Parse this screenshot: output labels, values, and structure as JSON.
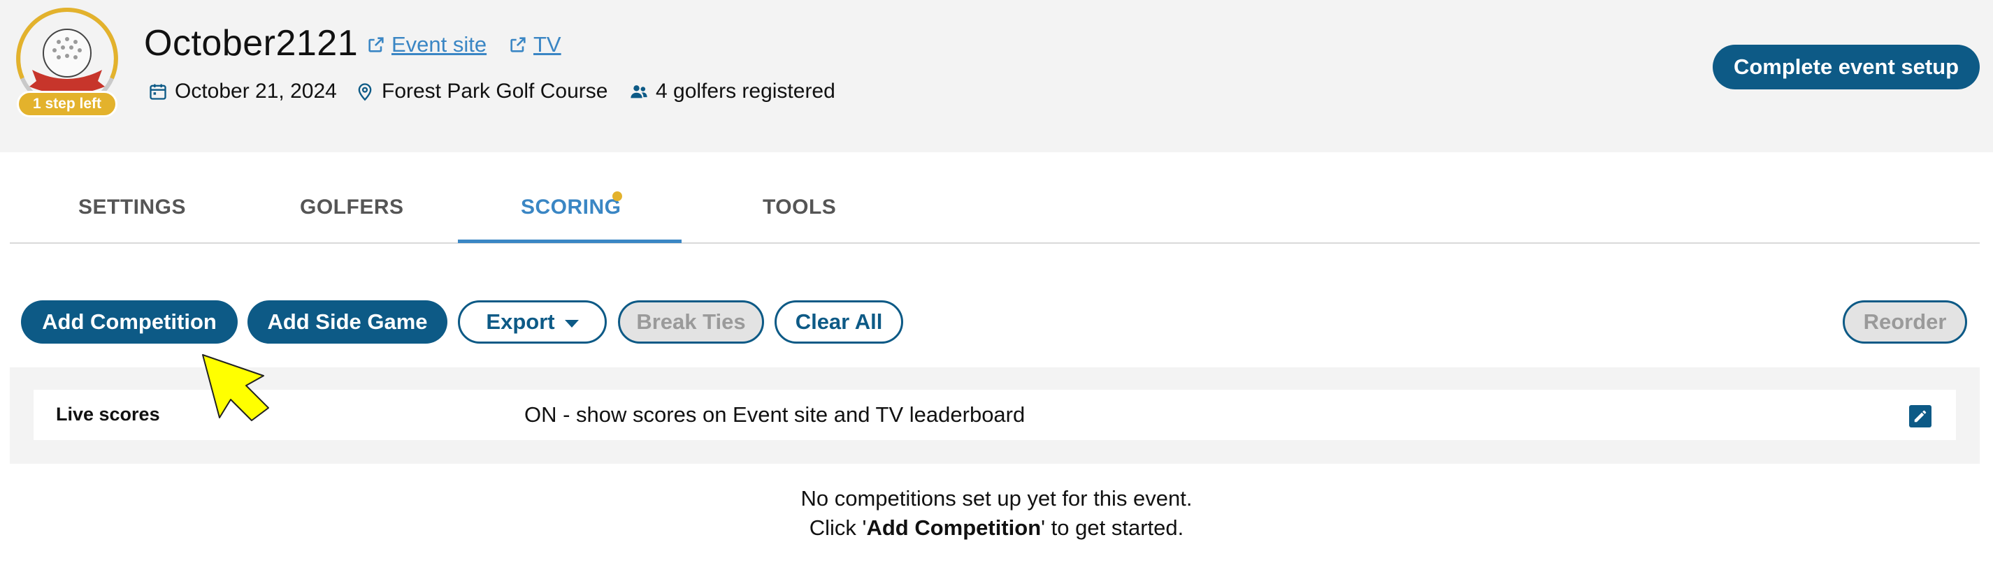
{
  "header": {
    "badge_label": "1 step left",
    "event_title": "October2121",
    "event_site_link": "Event site",
    "tv_link": "TV",
    "date": "October 21, 2024",
    "location": "Forest Park Golf Course",
    "golfers_registered": "4 golfers registered",
    "complete_setup_button": "Complete event setup"
  },
  "tabs": [
    {
      "label": "SETTINGS",
      "active": false
    },
    {
      "label": "GOLFERS",
      "active": false
    },
    {
      "label": "SCORING",
      "active": true,
      "notification_dot": true
    },
    {
      "label": "TOOLS",
      "active": false
    }
  ],
  "toolbar": {
    "add_competition": "Add Competition",
    "add_side_game": "Add Side Game",
    "export": "Export",
    "break_ties": "Break Ties",
    "clear_all": "Clear All",
    "reorder": "Reorder"
  },
  "live_scores": {
    "label": "Live scores",
    "value": "ON - show scores on Event site and TV leaderboard"
  },
  "empty_state": {
    "line1": "No competitions set up yet for this event.",
    "line2_prefix": "Click '",
    "line2_bold": "Add Competition",
    "line2_suffix": "' to get started."
  },
  "colors": {
    "primary": "#0d5a86",
    "link": "#3a86c4",
    "accent_gold": "#e3b22c",
    "header_bg": "#f3f3f3",
    "pointer_yellow": "#ffff00"
  },
  "icons": [
    "golf-ball-badge-icon",
    "external-link-icon",
    "calendar-icon",
    "location-pin-icon",
    "users-icon",
    "caret-down-icon",
    "pencil-edit-icon",
    "pointer-arrow-icon"
  ]
}
